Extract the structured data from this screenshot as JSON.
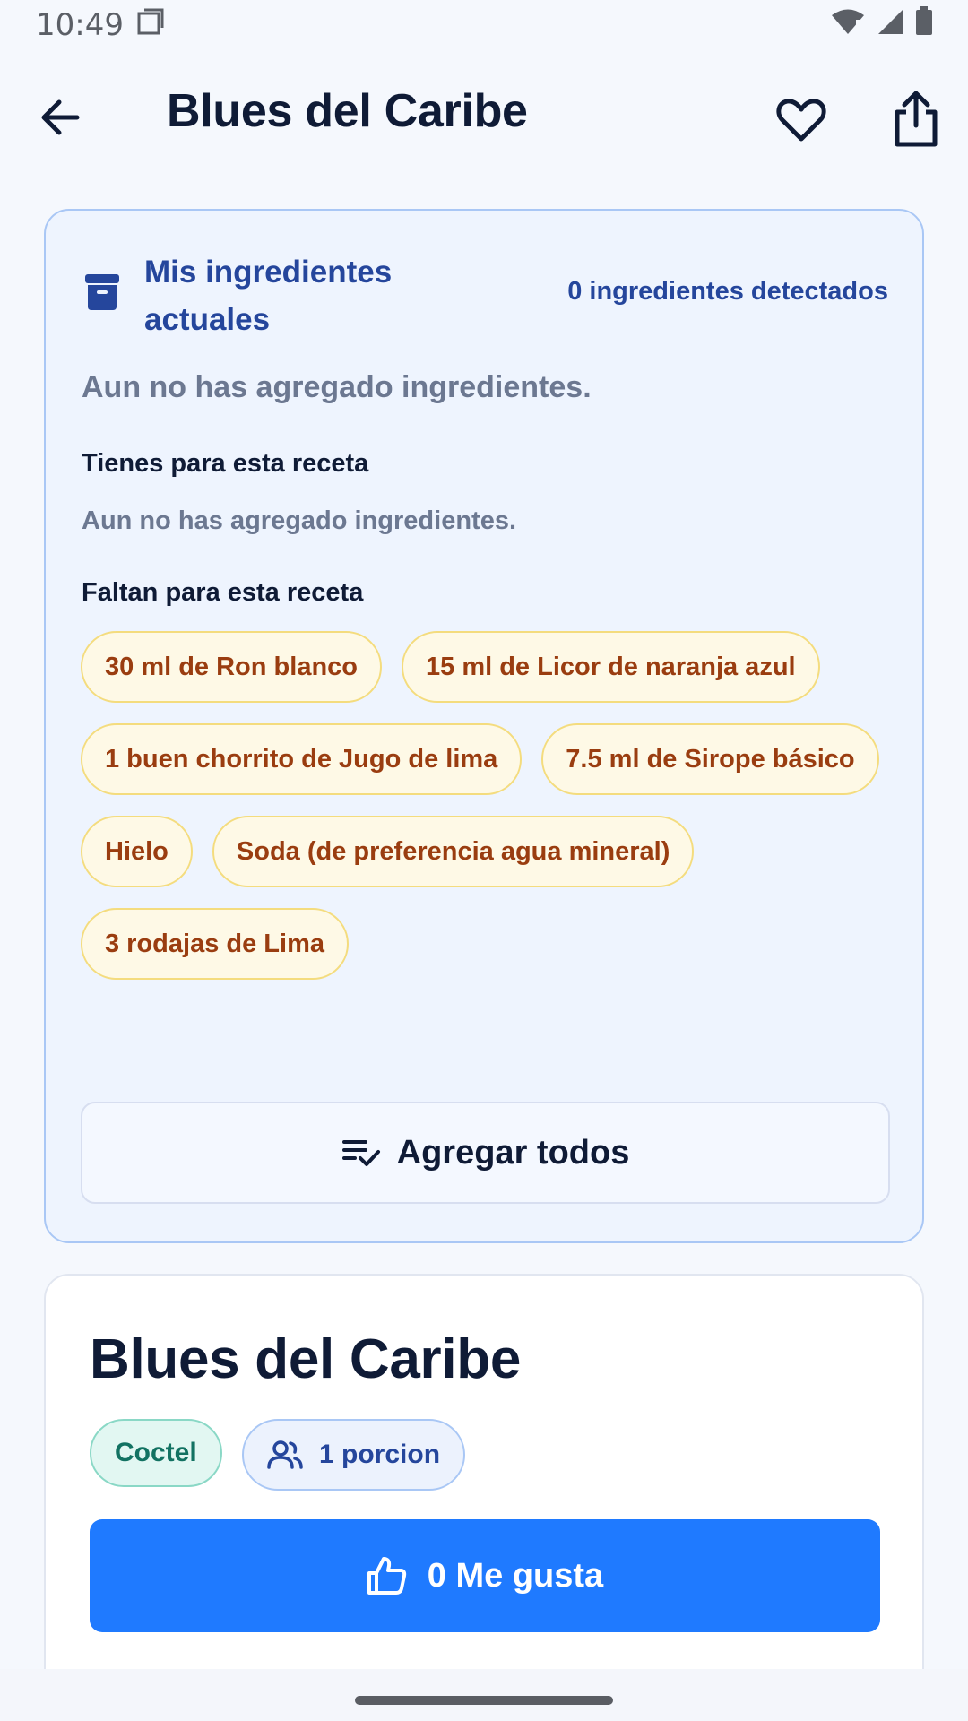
{
  "status_bar": {
    "time": "10:49"
  },
  "header": {
    "title": "Blues del Caribe"
  },
  "ingredients_panel": {
    "title": "Mis ingredientes actuales",
    "detected": "0 ingredientes detectados",
    "empty_message": "Aun no has agregado ingredientes.",
    "have_label": "Tienes para esta receta",
    "have_empty": "Aun no has agregado ingredientes.",
    "missing_label": "Faltan para esta receta",
    "missing": [
      "30 ml de Ron blanco",
      "15 ml de Licor de naranja azul",
      "1 buen chorrito de Jugo de lima",
      "7.5 ml de Sirope básico",
      "Hielo",
      "Soda (de preferencia agua mineral)",
      "3 rodajas de Lima"
    ],
    "add_all_label": "Agregar todos"
  },
  "recipe": {
    "title": "Blues del Caribe",
    "category": "Coctel",
    "portion": "1 porcion",
    "like_label": "0 Me gusta"
  },
  "colors": {
    "accent": "#1f7aff",
    "primary_text": "#0f1b36",
    "panel_title": "#25469c",
    "chip_text": "#9a3d10",
    "chip_bg": "#fef9e6"
  }
}
